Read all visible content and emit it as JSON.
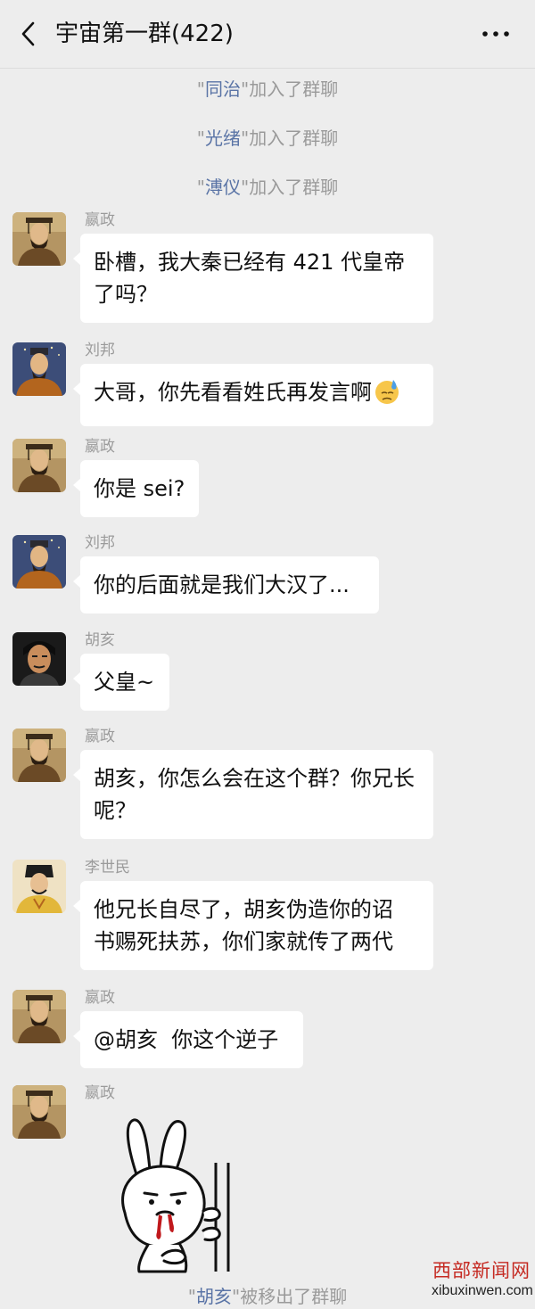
{
  "header": {
    "title": "宇宙第一群(422)",
    "back_icon": "chevron-left-icon",
    "more_icon": "more-dots-icon"
  },
  "system_messages": [
    {
      "name": "同治",
      "quote_open": "\"",
      "quote_close": "\"",
      "text": "加入了群聊"
    },
    {
      "name": "光绪",
      "quote_open": "\"",
      "quote_close": "\"",
      "text": "加入了群聊"
    },
    {
      "name": "溥仪",
      "quote_open": "\"",
      "quote_close": "\"",
      "text": "加入了群聊"
    },
    {
      "name": "胡亥",
      "quote_open": "\"",
      "quote_close": "\"",
      "text": "被移出了群聊"
    }
  ],
  "messages": [
    {
      "sender": "嬴政",
      "lines": [
        "卧槽，我大秦已经有 421 代皇帝",
        "了吗？"
      ]
    },
    {
      "sender": "刘邦",
      "lines": [
        "大哥，你先看看姓氏再发言啊"
      ],
      "emoji": "sweat-emoji"
    },
    {
      "sender": "嬴政",
      "lines": [
        "你是 sei?"
      ]
    },
    {
      "sender": "刘邦",
      "lines": [
        "你的后面就是我们大汉了..."
      ]
    },
    {
      "sender": "胡亥",
      "lines": [
        "父皇~"
      ]
    },
    {
      "sender": "嬴政",
      "lines": [
        "胡亥，你怎么会在这个群？你兄长",
        "呢？"
      ]
    },
    {
      "sender": "李世民",
      "lines": [
        "他兄长自尽了，胡亥伪造你的诏",
        "书赐死扶苏，你们家就传了两代"
      ]
    },
    {
      "sender": "嬴政",
      "lines": [
        "@胡亥  你这个逆子"
      ]
    },
    {
      "sender": "嬴政",
      "sticker": "bleeding-rabbit-sticker"
    }
  ],
  "watermark": {
    "cn": "西部新闻网",
    "en": "xibuxinwen.com"
  },
  "colors": {
    "background": "#ededed",
    "bubble": "#ffffff",
    "system_name": "#5a74a6",
    "system_text": "#9a9a9a",
    "watermark_red": "#c52a22"
  }
}
